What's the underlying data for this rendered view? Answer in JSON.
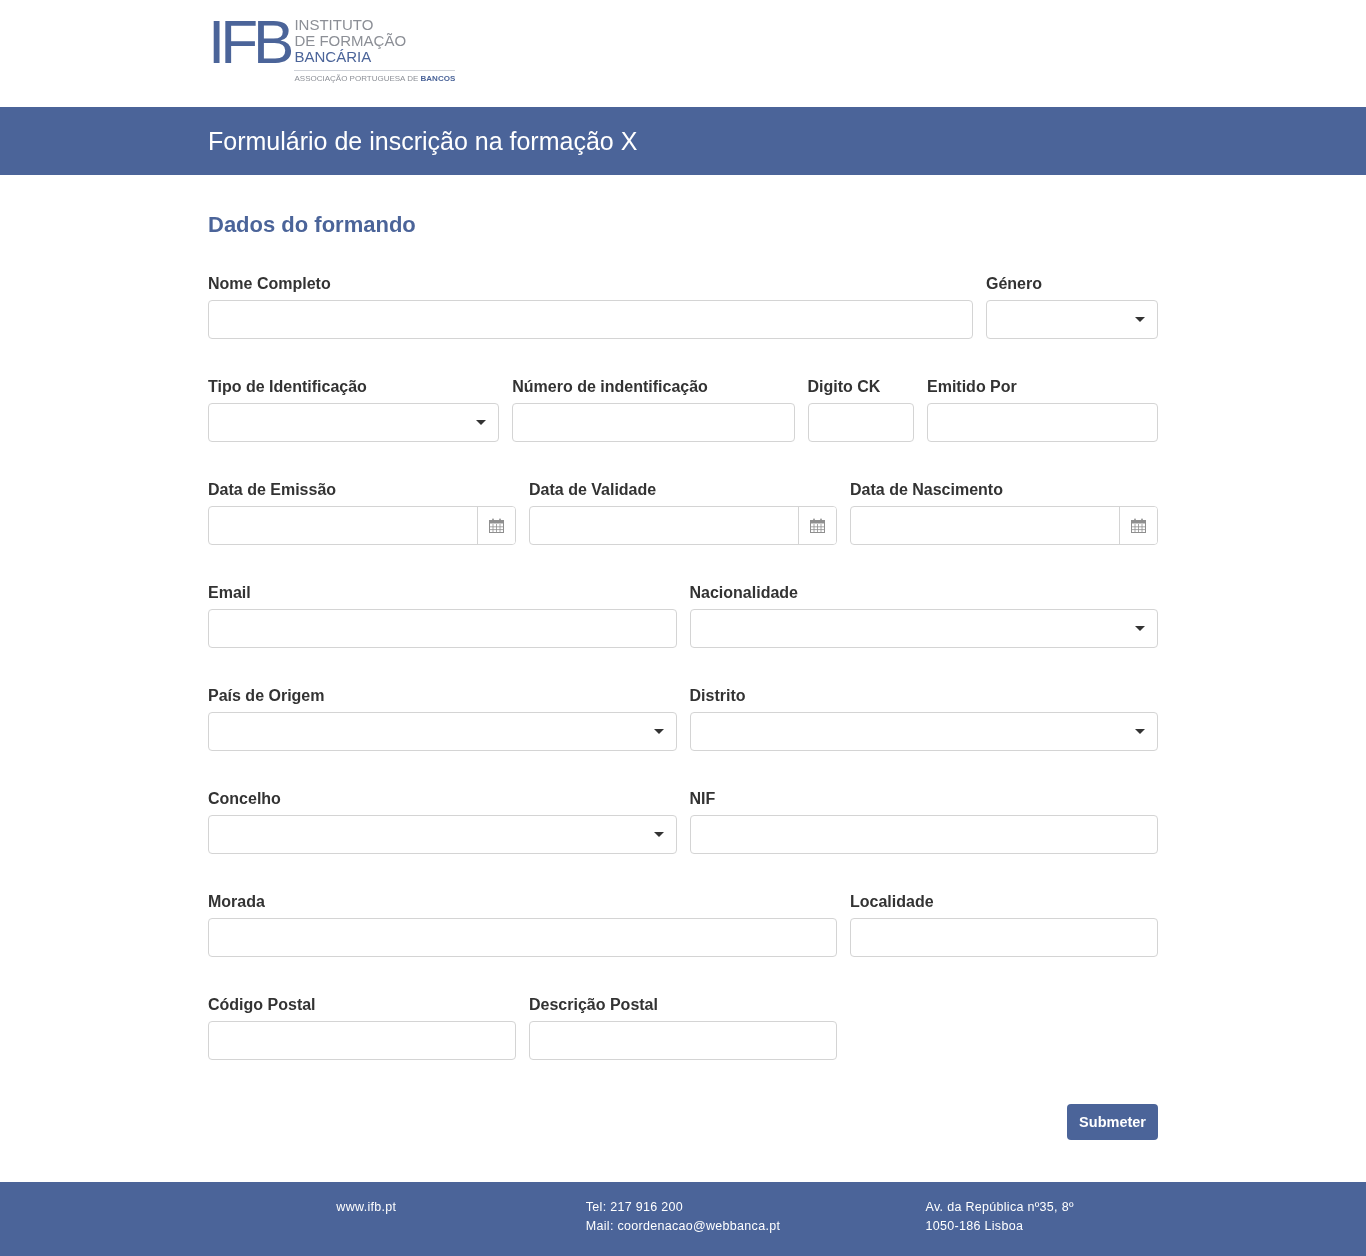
{
  "header": {
    "logo": {
      "mark": "IFB",
      "name_lines": [
        "INSTITUTO",
        "DE FORMAÇÃO"
      ],
      "name_accent": "BANCÁRIA",
      "tagline": "ASSOCIAÇÃO PORTUGUESA DE **BANCOS**"
    }
  },
  "banner": {
    "title": "Formulário de inscrição na formação X"
  },
  "form": {
    "section_title": "Dados do formando",
    "rows": [
      {
        "fields": [
          {
            "label": "Nome Completo",
            "kind": "text"
          },
          {
            "label": "Género",
            "kind": "select"
          }
        ]
      },
      {
        "fields": [
          {
            "label": "Tipo de Identificação",
            "kind": "select"
          },
          {
            "label": "Número de indentificação",
            "kind": "text"
          },
          {
            "label": "Digito CK",
            "kind": "text"
          },
          {
            "label": "Emitido Por",
            "kind": "text"
          }
        ]
      },
      {
        "fields": [
          {
            "label": "Data de Emissão",
            "kind": "date"
          },
          {
            "label": "Data de Validade",
            "kind": "date"
          },
          {
            "label": "Data de Nascimento",
            "kind": "date"
          }
        ]
      },
      {
        "fields": [
          {
            "label": "Email",
            "kind": "text"
          },
          {
            "label": "Nacionalidade",
            "kind": "select"
          }
        ]
      },
      {
        "fields": [
          {
            "label": "País de Origem",
            "kind": "select"
          },
          {
            "label": "Distrito",
            "kind": "select"
          }
        ]
      },
      {
        "fields": [
          {
            "label": "Concelho",
            "kind": "select"
          },
          {
            "label": "NIF",
            "kind": "text"
          }
        ]
      },
      {
        "fields": [
          {
            "label": "Morada",
            "kind": "text"
          },
          {
            "label": "Localidade",
            "kind": "text"
          }
        ]
      },
      {
        "fields": [
          {
            "label": "Código Postal",
            "kind": "text"
          },
          {
            "label": "Descrição Postal",
            "kind": "text"
          }
        ]
      }
    ],
    "submit_button": "Submeter"
  },
  "footer": {
    "columns": [
      {
        "lines": [
          "www.ifb.pt"
        ]
      },
      {
        "lines": [
          "Tel: 217 916 200",
          "Mail: coordenacao@webbanca.pt"
        ]
      },
      {
        "lines": [
          "Av. da República nº35, 8º",
          "1050-186 Lisboa"
        ]
      }
    ]
  }
}
